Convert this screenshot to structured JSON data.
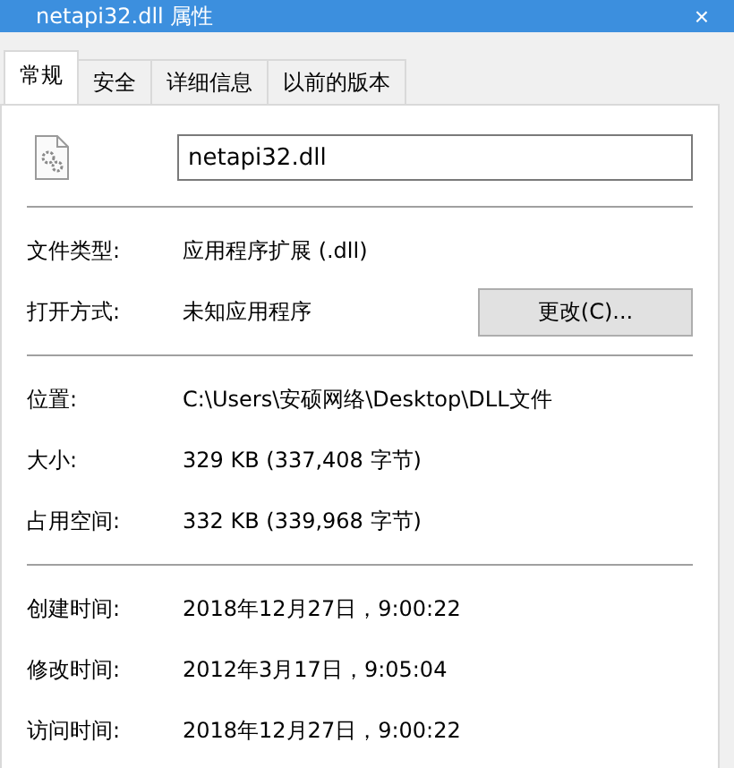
{
  "window": {
    "title": "netapi32.dll 属性",
    "close": "×"
  },
  "tabs": [
    {
      "label": "常规",
      "selected": true
    },
    {
      "label": "安全",
      "selected": false
    },
    {
      "label": "详细信息",
      "selected": false
    },
    {
      "label": "以前的版本",
      "selected": false
    }
  ],
  "file_name": {
    "value": "netapi32.dll"
  },
  "sections": [
    {
      "rows": [
        {
          "label": "文件类型:",
          "value": "应用程序扩展 (.dll)"
        },
        {
          "label": "打开方式:",
          "value": "未知应用程序",
          "button": "更改(C)..."
        }
      ]
    },
    {
      "rows": [
        {
          "label": "位置:",
          "value": "C:\\Users\\安硕网络\\Desktop\\DLL文件"
        },
        {
          "label": "大小:",
          "value": "329 KB (337,408 字节)"
        },
        {
          "label": "占用空间:",
          "value": "332 KB (339,968 字节)"
        }
      ]
    },
    {
      "rows": [
        {
          "label": "创建时间:",
          "value": "2018年12月27日，9:00:22"
        },
        {
          "label": "修改时间:",
          "value": "2012年3月17日，9:05:04"
        },
        {
          "label": "访问时间:",
          "value": "2018年12月27日，9:00:22"
        }
      ]
    }
  ]
}
